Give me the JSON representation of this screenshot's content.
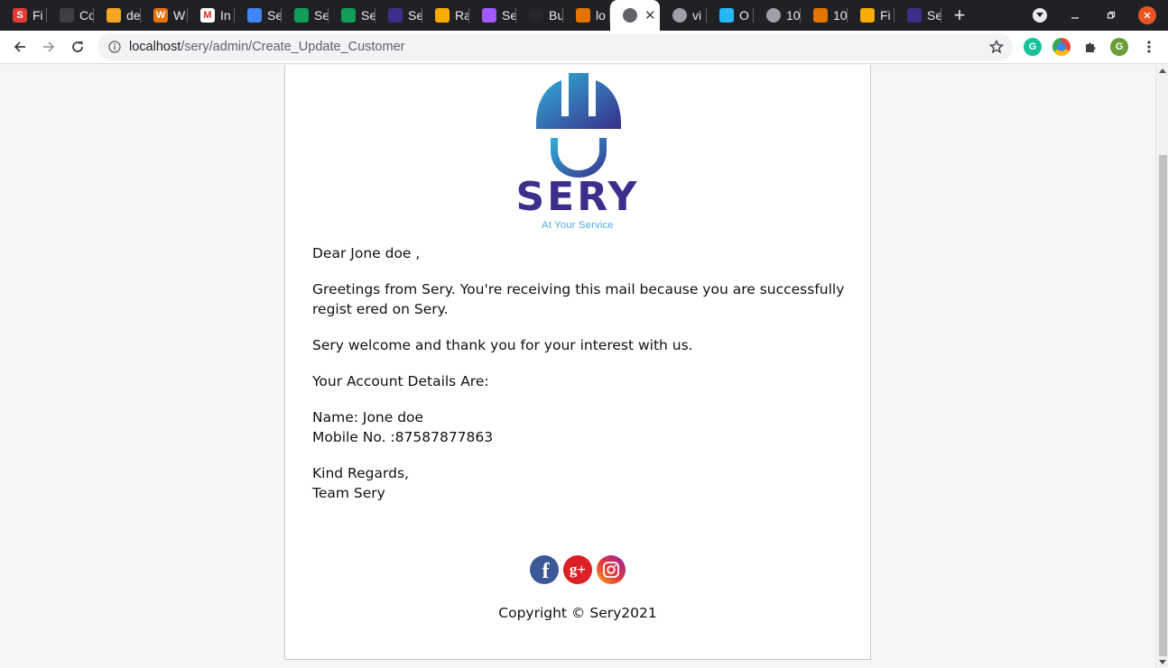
{
  "browser": {
    "tabs": [
      {
        "title": "Fi",
        "favicon_color": "#e53935",
        "favicon_glyph": "S",
        "icon": "s-app-icon"
      },
      {
        "title": "Co",
        "favicon_color": "#3c4043",
        "favicon_glyph": "",
        "icon": "code-icon"
      },
      {
        "title": "de",
        "favicon_color": "#f6a623",
        "favicon_glyph": "",
        "icon": "firebase-icon"
      },
      {
        "title": "W",
        "favicon_color": "#e8710a",
        "favicon_glyph": "W",
        "icon": "w-app-icon"
      },
      {
        "title": "In",
        "favicon_color": "#ffffff",
        "favicon_glyph": "M",
        "icon": "gmail-icon"
      },
      {
        "title": "Se",
        "favicon_color": "#4285f4",
        "favicon_glyph": "",
        "icon": "docs-icon"
      },
      {
        "title": "Se",
        "favicon_color": "#0f9d58",
        "favicon_glyph": "",
        "icon": "sheets-icon"
      },
      {
        "title": "Se",
        "favicon_color": "#0f9d58",
        "favicon_glyph": "",
        "icon": "sheets-icon"
      },
      {
        "title": "Se",
        "favicon_color": "#3a2f8a",
        "favicon_glyph": "",
        "icon": "sery-icon"
      },
      {
        "title": "Ra",
        "favicon_color": "#f9ab00",
        "favicon_glyph": "",
        "icon": "emoji-icon"
      },
      {
        "title": "Se",
        "favicon_color": "#a259ff",
        "favicon_glyph": "",
        "icon": "figma-icon"
      },
      {
        "title": "Bu",
        "favicon_color": "#24292e",
        "favicon_glyph": "",
        "icon": "github-icon"
      },
      {
        "title": "lo",
        "favicon_color": "#e37400",
        "favicon_glyph": "",
        "icon": "xampp-icon"
      },
      {
        "title": "",
        "favicon_color": "#5f6368",
        "favicon_glyph": "",
        "icon": "globe-icon",
        "active": true
      },
      {
        "title": "vi",
        "favicon_color": "#9aa0a6",
        "favicon_glyph": "",
        "icon": "globe-icon"
      },
      {
        "title": "O",
        "favicon_color": "#29b6f6",
        "favicon_glyph": "",
        "icon": "m-app-icon"
      },
      {
        "title": "10",
        "favicon_color": "#9aa0a6",
        "favicon_glyph": "",
        "icon": "globe-icon"
      },
      {
        "title": "10",
        "favicon_color": "#e37400",
        "favicon_glyph": "",
        "icon": "xampp-icon"
      },
      {
        "title": "Fi",
        "favicon_color": "#f9ab00",
        "favicon_glyph": "",
        "icon": "folder-icon"
      },
      {
        "title": "Se",
        "favicon_color": "#3a2f8a",
        "favicon_glyph": "",
        "icon": "sery-icon"
      }
    ],
    "url_host": "localhost",
    "url_path": "/sery/admin/Create_Update_Customer",
    "profile_initial": "G"
  },
  "email": {
    "brand_name": "SERY",
    "brand_tagline": "At Your Service",
    "greeting": "Dear Jone doe ,",
    "intro": "Greetings from Sery. You're receiving this mail because you are successfully regist ered on Sery.",
    "welcome": "Sery welcome and thank you for your interest with us.",
    "details_heading": "Your Account Details Are:",
    "name_line": "Name: Jone doe",
    "mobile_line": "Mobile No. :87587877863",
    "regards": "Kind Regards,",
    "team": "Team Sery",
    "copyright": "Copyright © Sery2021"
  },
  "colors": {
    "brand_purple": "#3a2f8a",
    "brand_blue": "#2e9bd6",
    "facebook": "#3b5998",
    "google_plus": "#dd1f26",
    "instagram": "#c13584"
  }
}
